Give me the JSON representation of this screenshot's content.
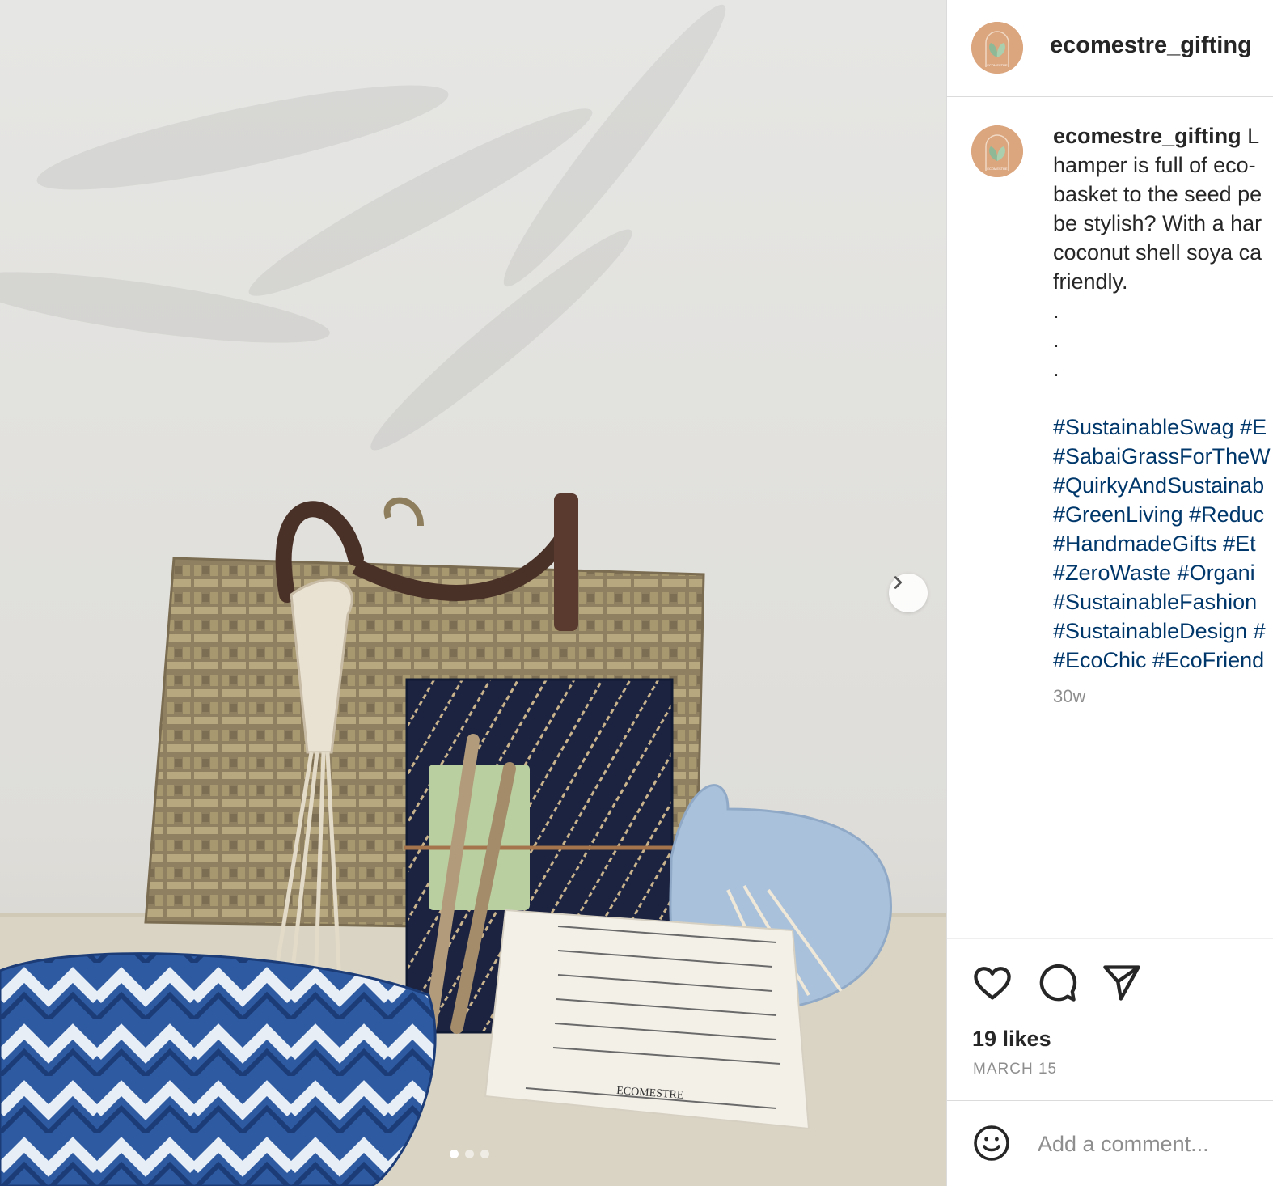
{
  "post": {
    "username": "ecomestre_gifting",
    "avatar_label": "ECOMESTRE",
    "photo_alt": "Eco-friendly gift hamper with sabai grass basket, handmade diary, seed pens, macrame keychain and product card",
    "card_brand": "ECOMESTRE",
    "caption_lines": [
      "hamper is full of eco-",
      "basket to the seed pe",
      "be stylish? With a har",
      "coconut shell soya ca",
      "friendly."
    ],
    "caption_first_fragment": "L",
    "dots": [
      ".",
      ".",
      "."
    ],
    "hashtags": [
      "#SustainableSwag #E",
      "#SabaiGrassForTheW",
      "#QuirkyAndSustainab",
      "#GreenLiving #Reduc",
      "#HandmadeGifts #Et",
      "#ZeroWaste #Organi",
      "#SustainableFashion",
      "#SustainableDesign #",
      "#EcoChic #EcoFriend"
    ],
    "time_ago": "30w",
    "likes": "19 likes",
    "date": "MARCH 15"
  },
  "comment": {
    "placeholder": "Add a comment..."
  },
  "carousel": {
    "slide_count": 3,
    "active_index": 0
  },
  "colors": {
    "avatar_bg": "#dba57e",
    "hashtag": "#00376b",
    "muted": "#8e8e8e",
    "text": "#262626"
  },
  "icons": [
    "chevron-right-icon",
    "heart-icon",
    "comment-icon",
    "share-icon",
    "emoji-icon"
  ]
}
